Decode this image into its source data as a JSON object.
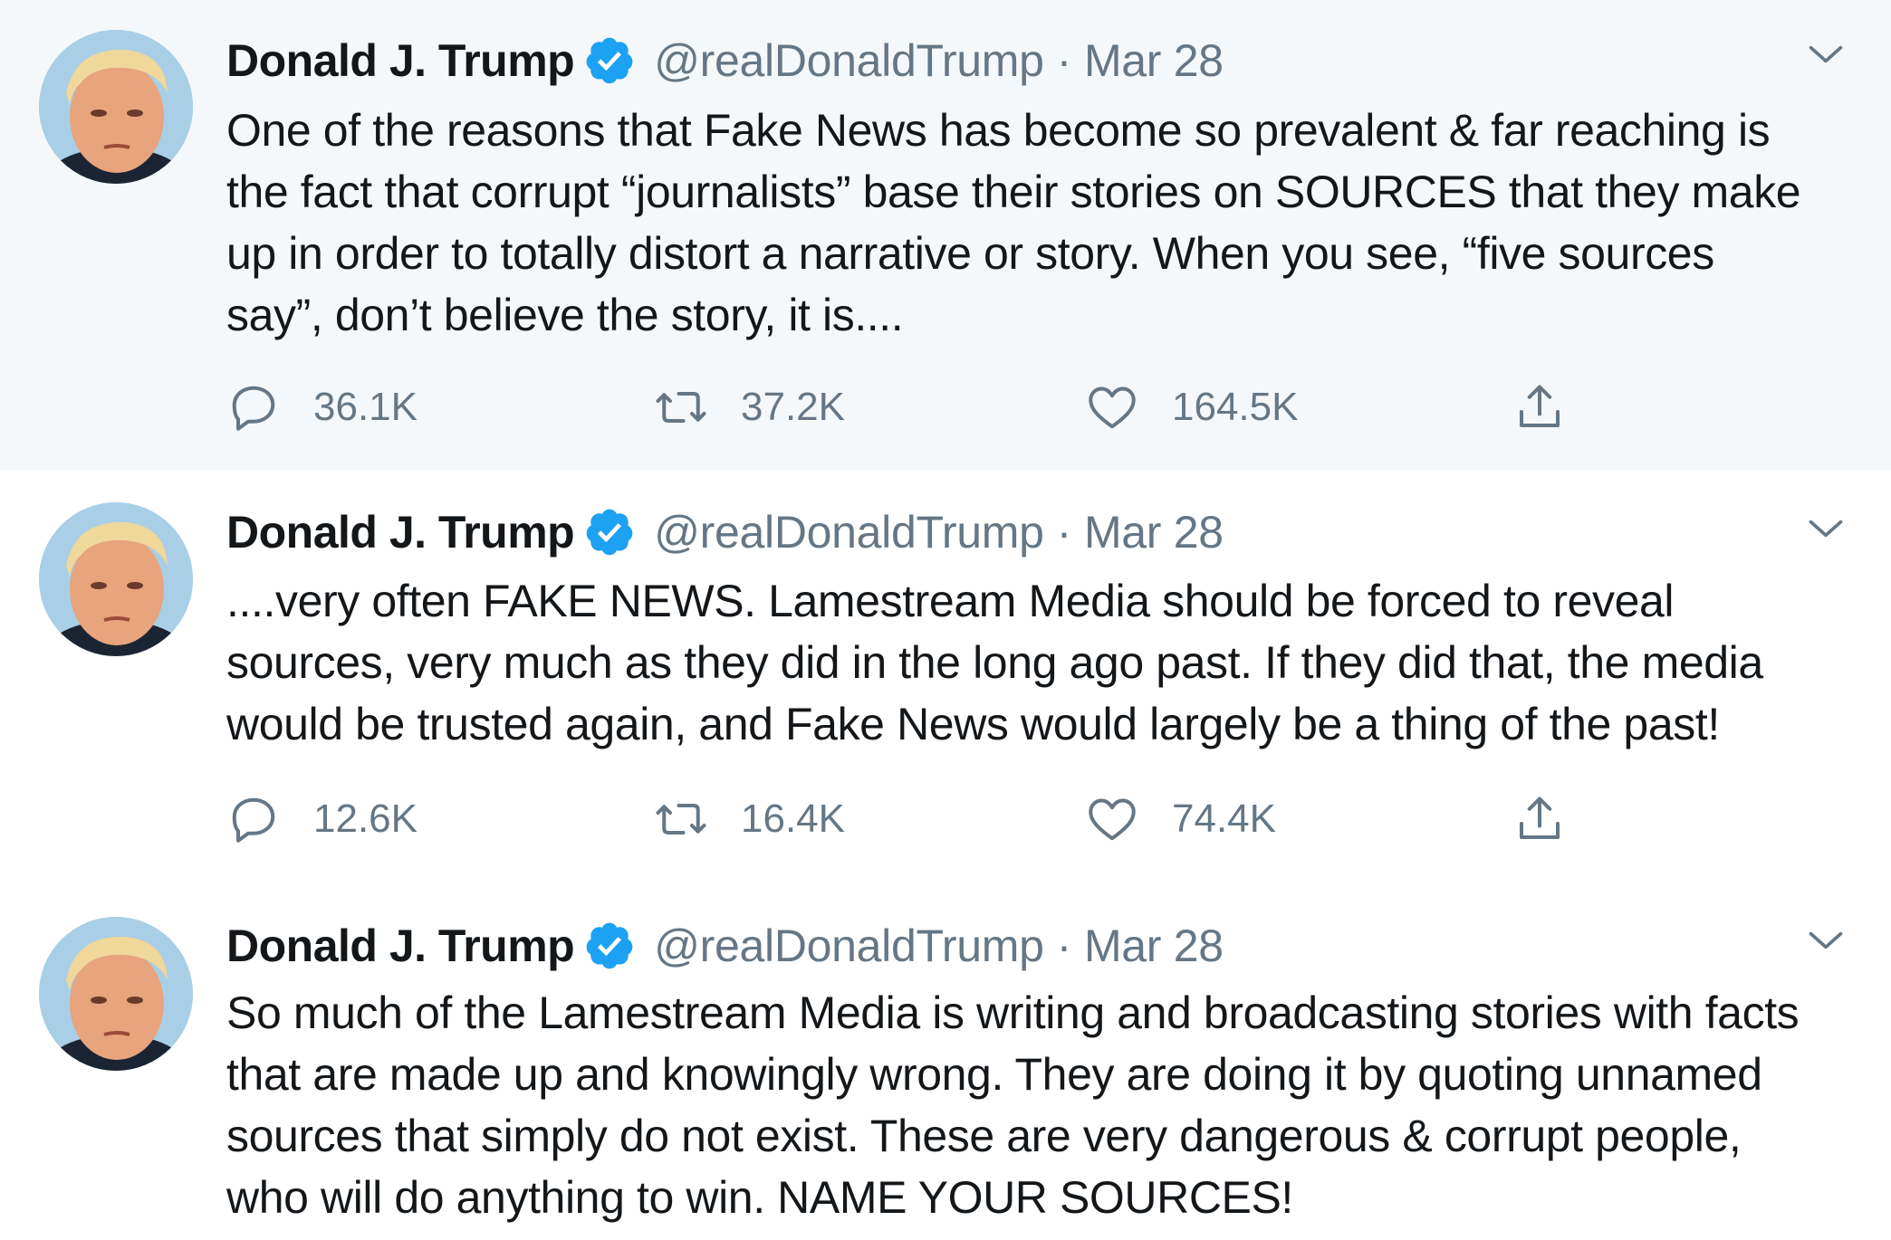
{
  "tweets": [
    {
      "name": "Donald J. Trump",
      "handle": "@realDonaldTrump",
      "separator": "·",
      "date": "Mar 28",
      "text": "One of the reasons that Fake News has become so prevalent & far reaching is the fact that corrupt “journalists” base their stories on SOURCES that they make up in order to totally distort a narrative or story. When you see, “five sources say”, don’t believe the story, it is....",
      "replies": "36.1K",
      "retweets": "37.2K",
      "likes": "164.5K"
    },
    {
      "name": "Donald J. Trump",
      "handle": "@realDonaldTrump",
      "separator": "·",
      "date": "Mar 28",
      "text": "....very often FAKE NEWS. Lamestream Media should be forced to reveal sources, very much as they did in the long ago past. If they did that, the media would be trusted again, and Fake News would largely be a thing of the past!",
      "replies": "12.6K",
      "retweets": "16.4K",
      "likes": "74.4K"
    },
    {
      "name": "Donald J. Trump",
      "handle": "@realDonaldTrump",
      "separator": "·",
      "date": "Mar 28",
      "text": "So much of the Lamestream Media is writing and broadcasting stories with facts that are made up and knowingly wrong. They are doing it by quoting unnamed sources that simply do not exist. These are very dangerous & corrupt people, who will do anything to win. NAME YOUR SOURCES!"
    }
  ],
  "icons": {
    "verified": "verified-badge-icon",
    "menu": "chevron-down-icon",
    "reply": "reply-icon",
    "retweet": "retweet-icon",
    "like": "heart-icon",
    "share": "share-icon"
  },
  "colors": {
    "thread_background": "#f5f8fa",
    "verified_blue": "#1da1f2",
    "secondary_text": "#657786",
    "primary_text": "#14171a",
    "thread_line": "#ccd6dd"
  }
}
